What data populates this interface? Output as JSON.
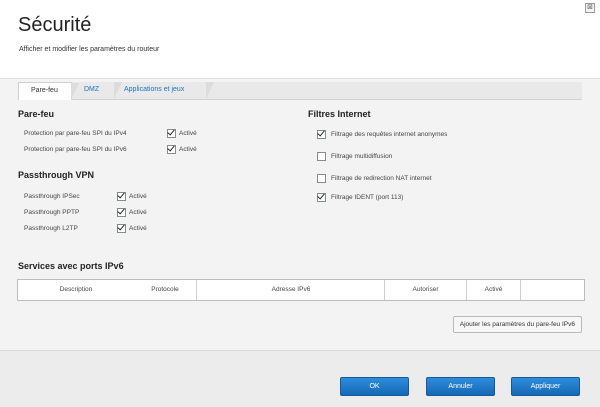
{
  "header": {
    "title": "Sécurité",
    "subtitle": "Afficher et modifier les paramètres du routeur",
    "close_glyph": "⊠"
  },
  "tabs": [
    {
      "label": "Pare-feu",
      "active": true
    },
    {
      "label": "DMZ",
      "active": false
    },
    {
      "label": "Applications et jeux",
      "active": false
    }
  ],
  "firewall": {
    "title": "Pare-feu",
    "rows": [
      {
        "label": "Protection par pare-feu SPI du IPv4",
        "checked": true,
        "check_label": "Activé"
      },
      {
        "label": "Protection par pare-feu SPI du IPv6",
        "checked": true,
        "check_label": "Activé"
      }
    ]
  },
  "vpn": {
    "title": "Passthrough VPN",
    "rows": [
      {
        "label": "Passthrough IPSec",
        "checked": true,
        "check_label": "Activé"
      },
      {
        "label": "Passthrough PPTP",
        "checked": true,
        "check_label": "Activé"
      },
      {
        "label": "Passthrough L2TP",
        "checked": true,
        "check_label": "Activé"
      }
    ]
  },
  "filters": {
    "title": "Filtres Internet",
    "items": [
      {
        "label": "Filtrage des requêtes internet anonymes",
        "checked": true
      },
      {
        "label": "Filtrage multidiffusion",
        "checked": false
      },
      {
        "label": "Filtrage de redirection NAT internet",
        "checked": false
      },
      {
        "label": "Filtrage IDENT (port 113)",
        "checked": true
      }
    ]
  },
  "ipv6_services": {
    "title": "Services avec ports IPv6",
    "columns": [
      "Description",
      "Protocole",
      "Adresse IPv6",
      "Autoriser",
      "Activé"
    ],
    "rows": [],
    "add_button": "Ajouter les paramètres du pare-feu IPv6"
  },
  "footer": {
    "ok": "OK",
    "cancel": "Annuler",
    "apply": "Appliquer"
  },
  "colors": {
    "accent": "#1b78c9",
    "tab_text": "#1a73c7"
  }
}
